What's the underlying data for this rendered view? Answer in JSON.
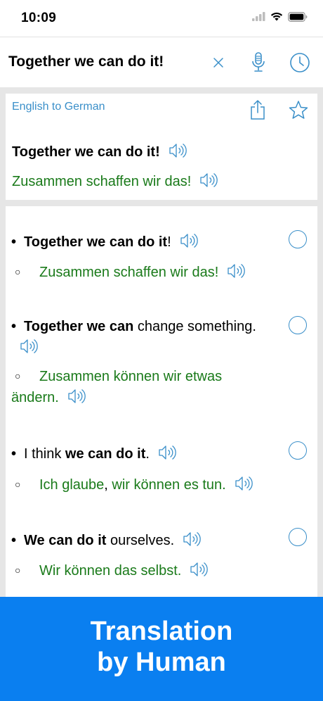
{
  "status": {
    "time": "10:09"
  },
  "search": {
    "query": "Together we can do it!"
  },
  "result": {
    "direction": "English to German",
    "source": "Together we can do it!",
    "target": "Zusammen schaffen wir das!"
  },
  "examples": [
    {
      "src_bold": "Together we can do it",
      "src_tail": "!",
      "target": "Zusammen schaffen wir das!"
    },
    {
      "src_bold": "Together we can",
      "src_tail": " change something.",
      "target": "Zusammen können wir etwas ändern."
    },
    {
      "src_pre": "I think ",
      "src_bold": "we can do it",
      "src_tail": ".",
      "target_pre": "Ich glaube",
      "target_sep": ",",
      "target_rest": " wir können es tun."
    },
    {
      "src_bold": "We can do it",
      "src_tail": " ourselves.",
      "target": "Wir können das selbst."
    }
  ],
  "banner": {
    "line1": "Translation",
    "line2": "by Human"
  },
  "colors": {
    "accent": "#3a8fc9",
    "translation": "#1a7a1a",
    "banner": "#0a7ff0"
  }
}
